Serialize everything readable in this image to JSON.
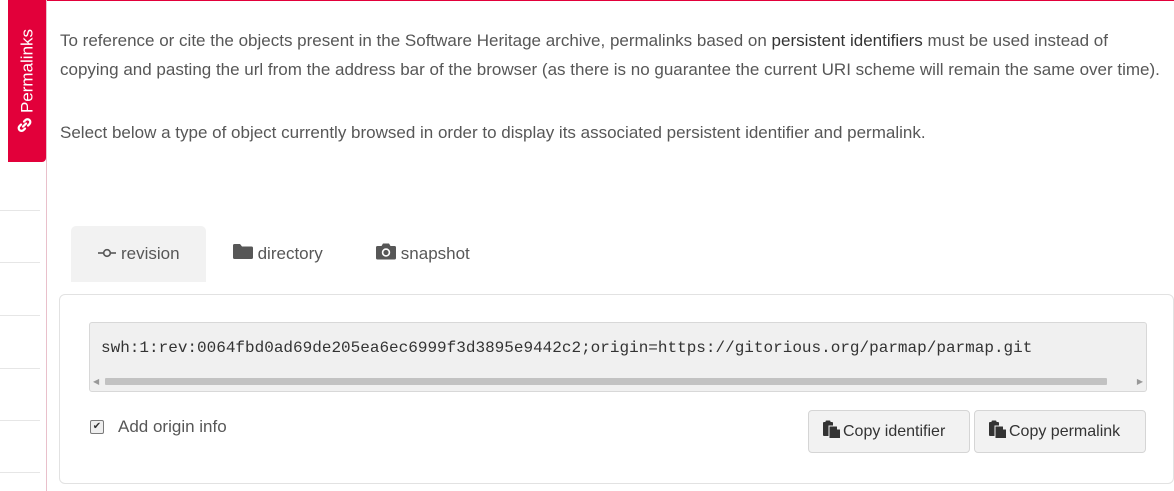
{
  "sidebar": {
    "tab_label": "Permalinks",
    "tab_icon": "link-icon"
  },
  "intro": {
    "text_before": "To reference or cite the objects present in the Software Heritage archive, permalinks based on ",
    "link_text": "persistent identifiers",
    "text_after": " must be used instead of copying and pasting the url from the address bar of the browser (as there is no guarantee the current URI scheme will remain the same over time).",
    "select_text": "Select below a type of object currently browsed in order to display its associated persistent identifier and permalink."
  },
  "tabs": [
    {
      "label": "revision",
      "icon": "commit-icon",
      "active": true
    },
    {
      "label": "directory",
      "icon": "folder-icon",
      "active": false
    },
    {
      "label": "snapshot",
      "icon": "camera-icon",
      "active": false
    }
  ],
  "identifier": {
    "value": "swh:1:rev:0064fbd0ad69de205ea6ec6999f3d3895e9442c2;origin=https://gitorious.org/parmap/parmap.git"
  },
  "options": {
    "add_origin_label": "Add origin info",
    "add_origin_checked": true
  },
  "buttons": {
    "copy_identifier": "Copy identifier",
    "copy_permalink": "Copy permalink"
  },
  "colors": {
    "accent": "#e2003a"
  }
}
